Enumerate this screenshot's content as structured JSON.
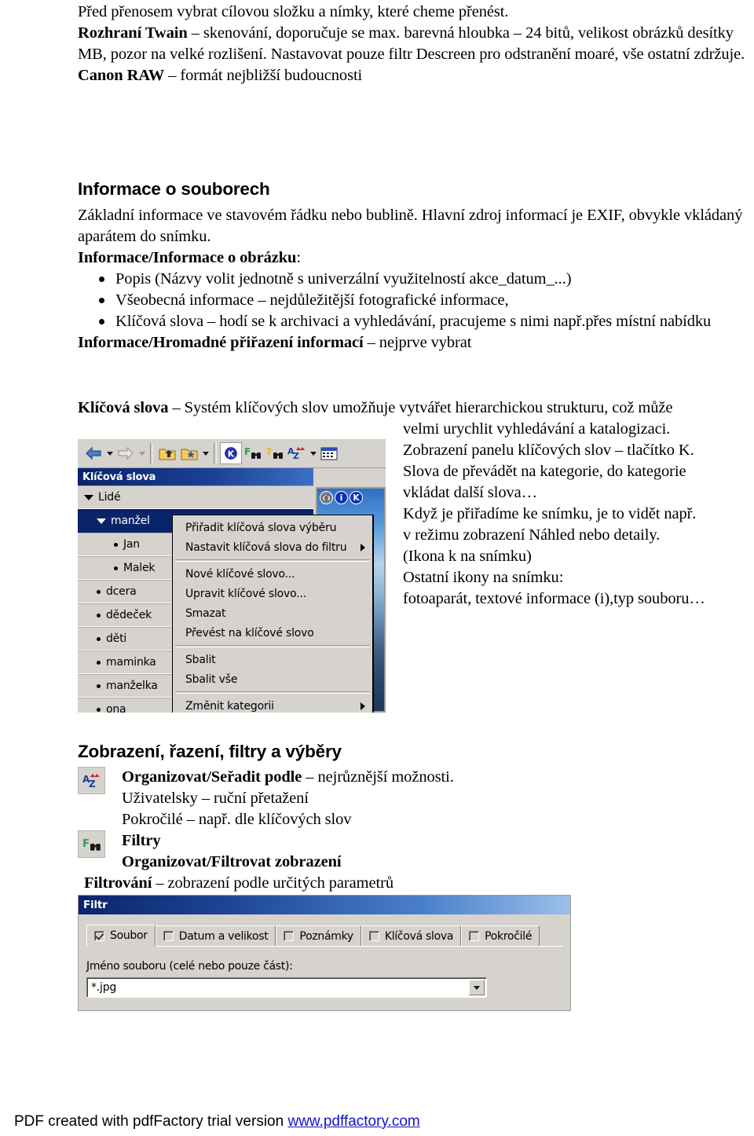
{
  "intro": {
    "lines": [
      "Před přenosem vybrat cílovou složku a nímky, které cheme přenést.",
      "Rozhraní Twain",
      " – skenování, doporučuje se max. barevná hloubka – 24 bitů, velikost obrázků desítky MB, pozor na velké rozlišení. Nastavovat pouze filtr Descreen pro odstranění moaré, vše ostatní zdržuje.",
      "Canon RAW",
      " – formát nejbližší budoucnosti"
    ],
    "line1": "Před přenosem vybrat cílovou složku a nímky, které cheme přenést.",
    "twain_label": "Rozhraní Twain",
    "twain_text": " – skenování, doporučuje se max. barevná hloubka – 24 bitů, velikost obrázků desítky MB, pozor na velké rozlišení. Nastavovat pouze filtr Descreen pro odstranění moaré, vše ostatní zdržuje.",
    "raw_label": "Canon RAW",
    "raw_text": " – formát nejbližší budoucnosti"
  },
  "info_section": {
    "heading": "Informace o souborech",
    "para1": "Základní informace ve stavovém řádku nebo bublině. Hlavní zdroj informací je EXIF, obvykle vkládaný aparátem do snímku.",
    "sub_label": "Informace/Informace o obrázku",
    "sub_label_suffix": ":",
    "bullets": [
      "Popis (Názvy volit jednotně s univerzální využitelností akce_datum_...)",
      "Všeobecná informace – nejdůležitější fotografické informace,",
      "Klíčová slova – hodí se k archivaci a vyhledávání, pracujeme s nimi např.přes místní nabídku"
    ],
    "bulk_label": "Informace/Hromadné přiřazení informací",
    "bulk_text": " – nejprve vybrat"
  },
  "keywords_section": {
    "lead_label": "Klíčová slova",
    "lead_text": " – Systém klíčových slov umožňuje vytvářet hierarchickou strukturu, což může",
    "right_lines": [
      "velmi urychlit vyhledávání a katalogizaci.",
      "Zobrazení panelu klíčových slov – tlačítko K.",
      "Slova de převádět na kategorie, do kategorie",
      "vkládat další slova…",
      "Když je přiřadíme ke snímku, je to vidět např.",
      "v režimu zobrazení Náhled nebo detaily.",
      "(Ikona k na snímku)",
      "Ostatní ikony na snímku:",
      "fotoaparát, textové informace (i),typ souboru…"
    ]
  },
  "screenshot": {
    "panel_title": "Klíčová slova",
    "toolbar": {
      "icons": [
        "back-arrow-icon",
        "back-dropdown-icon",
        "forward-arrow-icon",
        "forward-dropdown-icon",
        "folder-up-icon",
        "folder-new-icon",
        "folder-dropdown-icon",
        "keywords-k-icon",
        "filter-binoculars-icon",
        "search-binoculars-icon",
        "sort-az-icon",
        "sort-dropdown-icon",
        "details-view-icon"
      ],
      "k_label": "K"
    },
    "tree": [
      {
        "label": "Lidé",
        "level": 1,
        "marker": "caret",
        "selected": false
      },
      {
        "label": "manžel",
        "level": 2,
        "marker": "caret",
        "selected": true
      },
      {
        "label": "Jan",
        "level": 3,
        "marker": "dot",
        "selected": false
      },
      {
        "label": "Malek",
        "level": 3,
        "marker": "dot",
        "selected": false
      },
      {
        "label": "dcera",
        "level": 2,
        "marker": "dot",
        "selected": false
      },
      {
        "label": "dědeček",
        "level": 2,
        "marker": "dot",
        "selected": false
      },
      {
        "label": "děti",
        "level": 2,
        "marker": "dot",
        "selected": false
      },
      {
        "label": "maminka",
        "level": 2,
        "marker": "dot",
        "selected": false
      },
      {
        "label": "manželka",
        "level": 2,
        "marker": "dot",
        "selected": false
      },
      {
        "label": "ona",
        "level": 2,
        "marker": "dot",
        "selected": false
      }
    ],
    "context_menu": [
      {
        "label": "Přiřadit klíčová slova výběru",
        "submenu": false
      },
      {
        "label": "Nastavit klíčová slova do filtru",
        "submenu": true
      },
      {
        "separator": true
      },
      {
        "label": "Nové klíčové slovo...",
        "submenu": false
      },
      {
        "label": "Upravit klíčové slovo...",
        "submenu": false
      },
      {
        "label": "Smazat",
        "submenu": false
      },
      {
        "label": "Převést na klíčové slovo",
        "submenu": false
      },
      {
        "separator": true
      },
      {
        "label": "Sbalit",
        "submenu": false
      },
      {
        "label": "Sbalit vše",
        "submenu": false
      },
      {
        "separator": true
      },
      {
        "label": "Změnit kategorii",
        "submenu": true
      }
    ],
    "thumbnail_badges": [
      "camera-icon",
      "i",
      "K"
    ]
  },
  "sort_section": {
    "heading": "Zobrazení, řazení, filtry a výběry",
    "sort_label": "Organizovat/Seřadit podle",
    "sort_text": " – nejrůznější možnosti.",
    "line_user": "Uživatelsky – ruční přetažení",
    "line_advanced": "Pokročilé – např. dle klíčových slov",
    "filters_label": "Filtry",
    "filter_view_label": "Organizovat/Filtrovat zobrazení",
    "filtering_label": "Filtrování",
    "filtering_text": " – zobrazení podle určitých parametrů"
  },
  "filtr_dialog": {
    "title": "Filtr",
    "tabs": [
      {
        "label": "Soubor",
        "checked": true,
        "active": true
      },
      {
        "label": "Datum a velikost",
        "checked": false,
        "active": false
      },
      {
        "label": "Poznámky",
        "checked": false,
        "active": false
      },
      {
        "label": "Klíčová slova",
        "checked": false,
        "active": false
      },
      {
        "label": "Pokročilé",
        "checked": false,
        "active": false
      }
    ],
    "field_label_underlined": "J",
    "field_label_rest": "méno souboru (celé nebo pouze část):",
    "combo_value": "*.jpg"
  },
  "footer": {
    "text": "PDF created with pdfFactory trial version ",
    "link": "www.pdffactory.com"
  },
  "colors": {
    "title_navy": "#0a246a",
    "dialog_face": "#d6d3ce",
    "link_blue": "#1414c8",
    "accent_red": "#cc2020"
  }
}
